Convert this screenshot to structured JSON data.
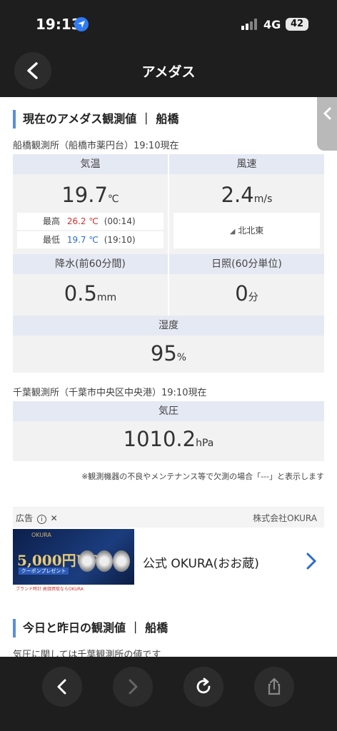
{
  "status": {
    "time": "19:13",
    "network": "4G",
    "battery": "42"
  },
  "header": {
    "title": "アメダス"
  },
  "section1": {
    "title": "現在のアメダス観測値 ｜ 船橋",
    "station": "船橋観測所（船橋市薬円台）19:10現在",
    "temp": {
      "label": "気温",
      "value": "19.7",
      "unit": "℃",
      "max_label": "最高",
      "max_value": "26.2 ℃",
      "max_time": "(00:14)",
      "min_label": "最低",
      "min_value": "19.7 ℃",
      "min_time": "(19:10)"
    },
    "wind": {
      "label": "風速",
      "value": "2.4",
      "unit": "m/s",
      "direction": "北北東"
    },
    "precip": {
      "label": "降水(前60分間)",
      "value": "0.5",
      "unit": "mm"
    },
    "sun": {
      "label": "日照(60分単位)",
      "value": "0",
      "unit": "分"
    },
    "humidity": {
      "label": "湿度",
      "value": "95",
      "unit": "%"
    }
  },
  "section2": {
    "station": "千葉観測所（千葉市中央区中央港）19:10現在",
    "pressure": {
      "label": "気圧",
      "value": "1010.2",
      "unit": "hPa"
    },
    "note": "※観測機器の不良やメンテナンス等で欠測の場合「---」と表示します"
  },
  "ad": {
    "label": "広告",
    "sponsor": "株式会社OKURA",
    "image_brand": "OKURA",
    "image_amount": "5,000円UP",
    "image_coupon": "クーポンプレゼント",
    "image_foot": "ブランド時計 高価買取ならOKURA",
    "text": "公式 OKURA(おお蔵)"
  },
  "section3": {
    "title": "今日と昨日の観測値 ｜ 船橋",
    "sub": "気圧に関しては千葉観測所の値です"
  },
  "colors": {
    "accent": "#5b8fd6",
    "max": "#d32f2f",
    "min": "#2f6ad0"
  }
}
